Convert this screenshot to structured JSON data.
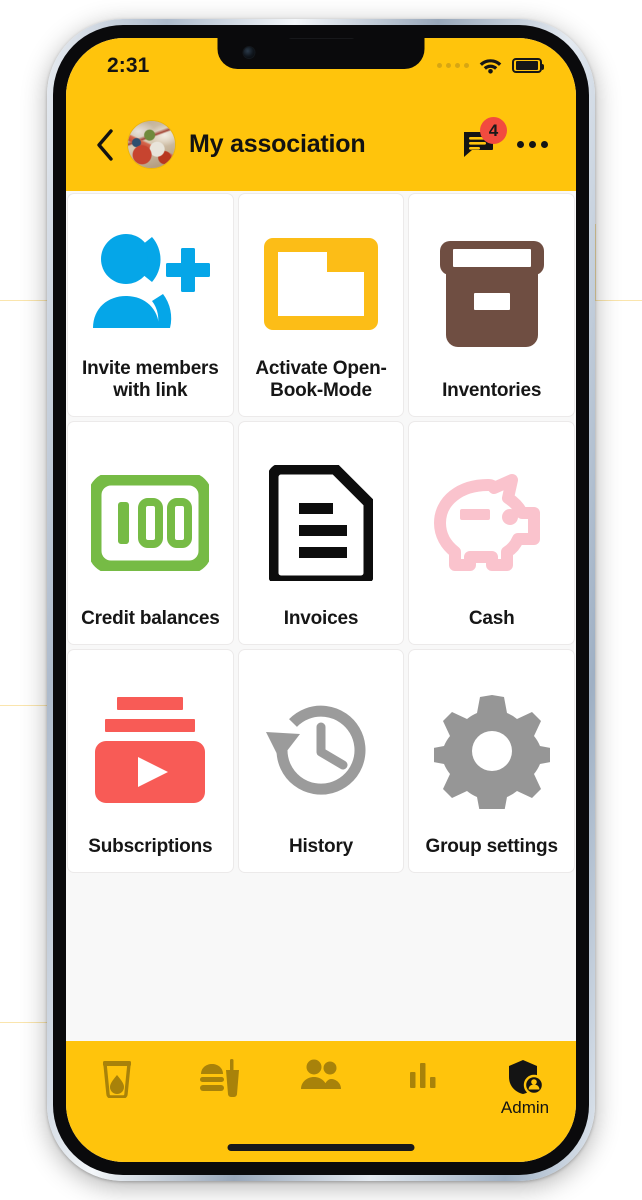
{
  "status_bar": {
    "time": "2:31",
    "signal_icon": "signal-dots-icon",
    "wifi_icon": "wifi-icon",
    "battery_icon": "battery-full-icon"
  },
  "app_bar": {
    "back_icon": "back-chevron-icon",
    "avatar_icon": "group-avatar-image",
    "title": "My association",
    "chat_icon": "chat-bubble-icon",
    "chat_badge_count": "4",
    "overflow_icon": "more-options-icon"
  },
  "colors": {
    "brand_yellow": "#ffc40c",
    "badge_red": "#f24b3f",
    "invite_blue": "#05a6e8",
    "folder_yellow": "#fcbd17",
    "inventory_brown": "#6f4e42",
    "credit_green": "#76bb45",
    "invoice_black": "#0d0d0d",
    "cash_pink": "#fac3cd",
    "subscription_red": "#f85b56",
    "history_gray": "#9b9b9b",
    "settings_gray": "#969696",
    "nav_inactive": "#a8820a",
    "page_background": "#f8f8f8"
  },
  "grid": {
    "tiles": [
      {
        "id": "invite-members",
        "label": "Invite members with link",
        "icon": "person-add-icon"
      },
      {
        "id": "open-book-mode",
        "label": "Activate Open-Book-Mode",
        "icon": "folder-icon"
      },
      {
        "id": "inventories",
        "label": "Inventories",
        "icon": "archive-box-icon"
      },
      {
        "id": "credit-balances",
        "label": "Credit balances",
        "icon": "money-100-icon"
      },
      {
        "id": "invoices",
        "label": "Invoices",
        "icon": "document-lines-icon"
      },
      {
        "id": "cash",
        "label": "Cash",
        "icon": "piggy-bank-icon"
      },
      {
        "id": "subscriptions",
        "label": "Subscriptions",
        "icon": "subscriptions-play-icon"
      },
      {
        "id": "history",
        "label": "History",
        "icon": "history-clock-icon"
      },
      {
        "id": "group-settings",
        "label": "Group settings",
        "icon": "gear-icon"
      }
    ]
  },
  "bottom_nav": {
    "items": [
      {
        "id": "drinks",
        "label": "",
        "icon": "drink-cup-icon",
        "active": false
      },
      {
        "id": "food",
        "label": "",
        "icon": "fast-food-icon",
        "active": false
      },
      {
        "id": "members",
        "label": "",
        "icon": "people-icon",
        "active": false
      },
      {
        "id": "stats",
        "label": "",
        "icon": "bar-chart-icon",
        "active": false
      },
      {
        "id": "admin",
        "label": "Admin",
        "icon": "shield-person-icon",
        "active": true
      }
    ]
  }
}
